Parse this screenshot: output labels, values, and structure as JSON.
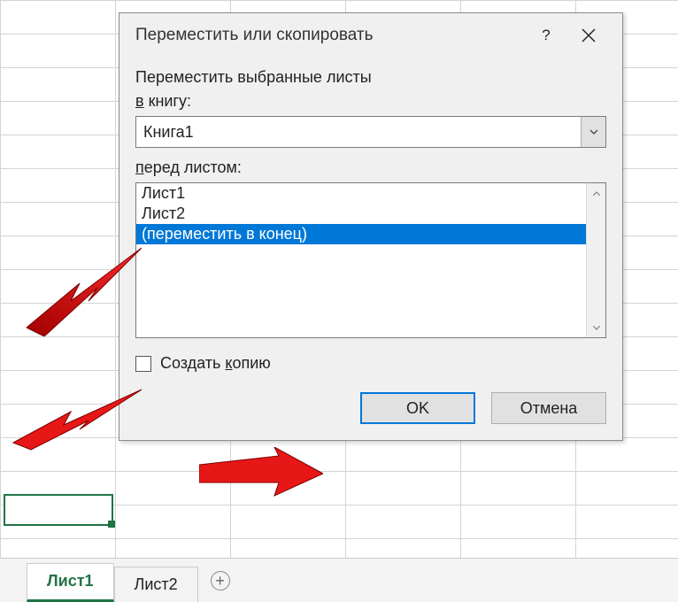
{
  "dialog": {
    "title": "Переместить или скопировать",
    "instruction": "Переместить выбранные листы",
    "book_label_pre": "",
    "book_label_u": "в",
    "book_label_post": " книгу:",
    "book_value": "Книга1",
    "before_label_pre": "",
    "before_label_u": "п",
    "before_label_post": "еред листом:",
    "sheets": {
      "0": "Лист1",
      "1": "Лист2",
      "2": "(переместить в конец)"
    },
    "copy_label_pre": "Создать ",
    "copy_label_u": "к",
    "copy_label_post": "опию",
    "ok": "OK",
    "cancel": "Отмена"
  },
  "tabs": {
    "0": "Лист1",
    "1": "Лист2"
  }
}
